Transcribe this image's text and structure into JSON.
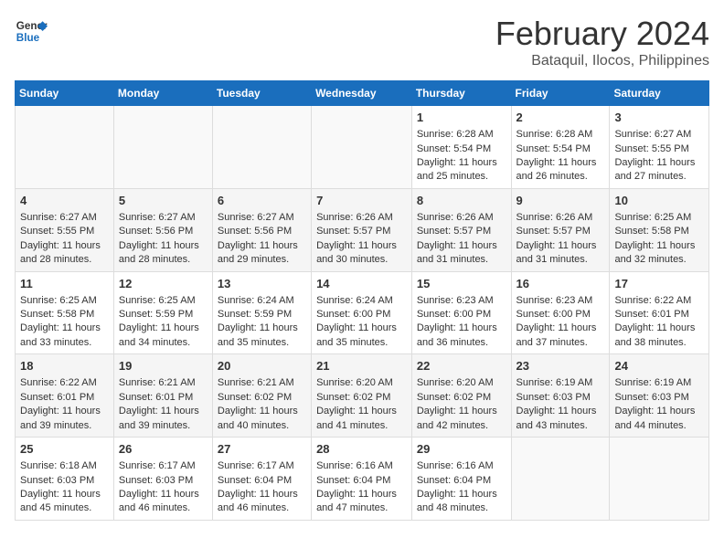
{
  "app": {
    "name": "GeneralBlue",
    "logo_text_1": "General",
    "logo_text_2": "Blue"
  },
  "calendar": {
    "title": "February 2024",
    "subtitle": "Bataquil, Ilocos, Philippines"
  },
  "weekdays": [
    "Sunday",
    "Monday",
    "Tuesday",
    "Wednesday",
    "Thursday",
    "Friday",
    "Saturday"
  ],
  "weeks": [
    [
      {
        "day": "",
        "empty": true
      },
      {
        "day": "",
        "empty": true
      },
      {
        "day": "",
        "empty": true
      },
      {
        "day": "",
        "empty": true
      },
      {
        "day": "1",
        "sunrise": "6:28 AM",
        "sunset": "5:54 PM",
        "daylight": "11 hours and 25 minutes."
      },
      {
        "day": "2",
        "sunrise": "6:28 AM",
        "sunset": "5:54 PM",
        "daylight": "11 hours and 26 minutes."
      },
      {
        "day": "3",
        "sunrise": "6:27 AM",
        "sunset": "5:55 PM",
        "daylight": "11 hours and 27 minutes."
      }
    ],
    [
      {
        "day": "4",
        "sunrise": "6:27 AM",
        "sunset": "5:55 PM",
        "daylight": "11 hours and 28 minutes."
      },
      {
        "day": "5",
        "sunrise": "6:27 AM",
        "sunset": "5:56 PM",
        "daylight": "11 hours and 28 minutes."
      },
      {
        "day": "6",
        "sunrise": "6:27 AM",
        "sunset": "5:56 PM",
        "daylight": "11 hours and 29 minutes."
      },
      {
        "day": "7",
        "sunrise": "6:26 AM",
        "sunset": "5:57 PM",
        "daylight": "11 hours and 30 minutes."
      },
      {
        "day": "8",
        "sunrise": "6:26 AM",
        "sunset": "5:57 PM",
        "daylight": "11 hours and 31 minutes."
      },
      {
        "day": "9",
        "sunrise": "6:26 AM",
        "sunset": "5:57 PM",
        "daylight": "11 hours and 31 minutes."
      },
      {
        "day": "10",
        "sunrise": "6:25 AM",
        "sunset": "5:58 PM",
        "daylight": "11 hours and 32 minutes."
      }
    ],
    [
      {
        "day": "11",
        "sunrise": "6:25 AM",
        "sunset": "5:58 PM",
        "daylight": "11 hours and 33 minutes."
      },
      {
        "day": "12",
        "sunrise": "6:25 AM",
        "sunset": "5:59 PM",
        "daylight": "11 hours and 34 minutes."
      },
      {
        "day": "13",
        "sunrise": "6:24 AM",
        "sunset": "5:59 PM",
        "daylight": "11 hours and 35 minutes."
      },
      {
        "day": "14",
        "sunrise": "6:24 AM",
        "sunset": "6:00 PM",
        "daylight": "11 hours and 35 minutes."
      },
      {
        "day": "15",
        "sunrise": "6:23 AM",
        "sunset": "6:00 PM",
        "daylight": "11 hours and 36 minutes."
      },
      {
        "day": "16",
        "sunrise": "6:23 AM",
        "sunset": "6:00 PM",
        "daylight": "11 hours and 37 minutes."
      },
      {
        "day": "17",
        "sunrise": "6:22 AM",
        "sunset": "6:01 PM",
        "daylight": "11 hours and 38 minutes."
      }
    ],
    [
      {
        "day": "18",
        "sunrise": "6:22 AM",
        "sunset": "6:01 PM",
        "daylight": "11 hours and 39 minutes."
      },
      {
        "day": "19",
        "sunrise": "6:21 AM",
        "sunset": "6:01 PM",
        "daylight": "11 hours and 39 minutes."
      },
      {
        "day": "20",
        "sunrise": "6:21 AM",
        "sunset": "6:02 PM",
        "daylight": "11 hours and 40 minutes."
      },
      {
        "day": "21",
        "sunrise": "6:20 AM",
        "sunset": "6:02 PM",
        "daylight": "11 hours and 41 minutes."
      },
      {
        "day": "22",
        "sunrise": "6:20 AM",
        "sunset": "6:02 PM",
        "daylight": "11 hours and 42 minutes."
      },
      {
        "day": "23",
        "sunrise": "6:19 AM",
        "sunset": "6:03 PM",
        "daylight": "11 hours and 43 minutes."
      },
      {
        "day": "24",
        "sunrise": "6:19 AM",
        "sunset": "6:03 PM",
        "daylight": "11 hours and 44 minutes."
      }
    ],
    [
      {
        "day": "25",
        "sunrise": "6:18 AM",
        "sunset": "6:03 PM",
        "daylight": "11 hours and 45 minutes."
      },
      {
        "day": "26",
        "sunrise": "6:17 AM",
        "sunset": "6:03 PM",
        "daylight": "11 hours and 46 minutes."
      },
      {
        "day": "27",
        "sunrise": "6:17 AM",
        "sunset": "6:04 PM",
        "daylight": "11 hours and 46 minutes."
      },
      {
        "day": "28",
        "sunrise": "6:16 AM",
        "sunset": "6:04 PM",
        "daylight": "11 hours and 47 minutes."
      },
      {
        "day": "29",
        "sunrise": "6:16 AM",
        "sunset": "6:04 PM",
        "daylight": "11 hours and 48 minutes."
      },
      {
        "day": "",
        "empty": true
      },
      {
        "day": "",
        "empty": true
      }
    ]
  ],
  "labels": {
    "sunrise": "Sunrise:",
    "sunset": "Sunset:",
    "daylight": "Daylight:"
  }
}
